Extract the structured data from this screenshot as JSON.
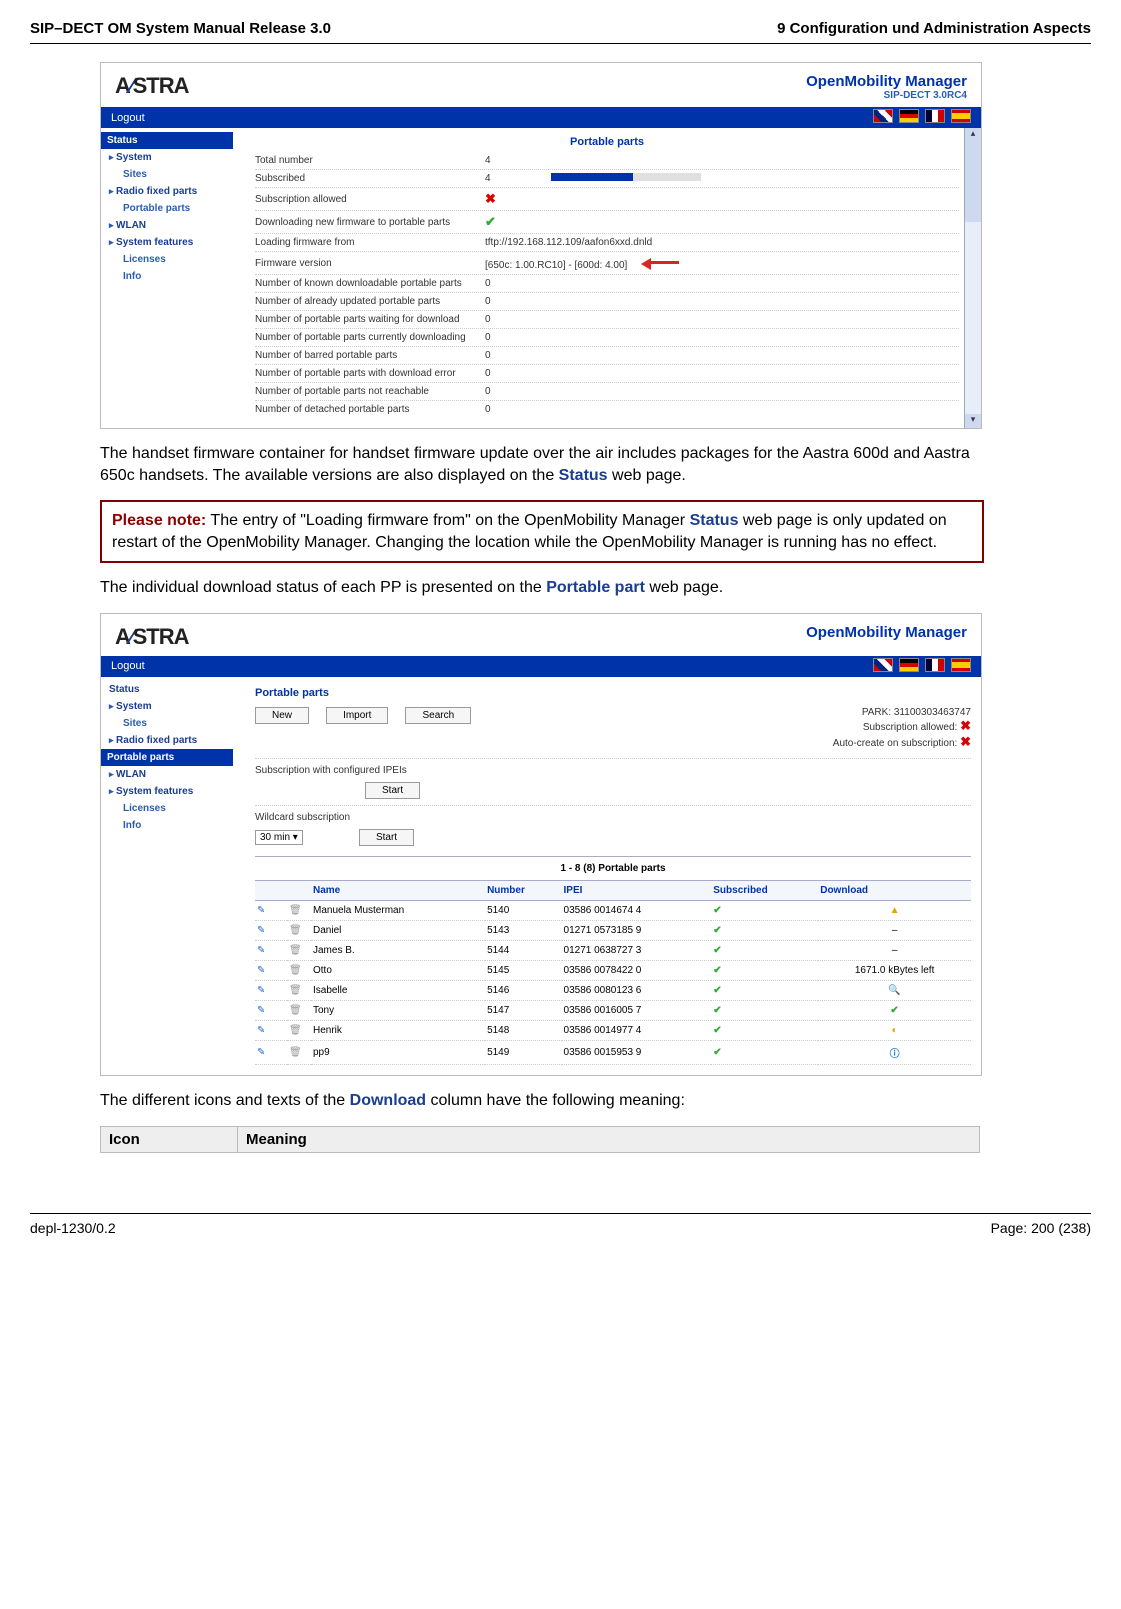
{
  "header": {
    "left": "SIP–DECT OM System Manual Release 3.0",
    "right": "9 Configuration und Administration Aspects"
  },
  "footer": {
    "left": "depl-1230/0.2",
    "right": "Page: 200 (238)"
  },
  "para1_a": "The handset firmware container for handset firmware update over the air includes packages for the Aastra 600d and Aastra 650c handsets. The available versions are also displayed on the ",
  "para1_link": "Status",
  "para1_b": " web page.",
  "note_label": "Please note:",
  "note_a": "The entry of \"Loading firmware from\" on the OpenMobility Manager ",
  "note_link": "Status",
  "note_b": " web page is only updated on restart of the OpenMobility Manager. Changing the location while the OpenMobility Manager is running has no effect.",
  "para2_a": "The individual download status of each PP is presented on the ",
  "para2_link": "Portable part",
  "para2_b": " web page.",
  "para3_a": "The different icons and texts of the ",
  "para3_link": "Download",
  "para3_b": " column have the following meaning:",
  "meaning_hdr": {
    "c1": "Icon",
    "c2": "Meaning"
  },
  "scr1": {
    "logo": "AASTRA",
    "omm_title": "OpenMobility Manager",
    "omm_sub": "SIP-DECT 3.0RC4",
    "logout": "Logout",
    "side": [
      "Status",
      "System",
      "Sites",
      "Radio fixed parts",
      "Portable parts",
      "WLAN",
      "System features",
      "Licenses",
      "Info"
    ],
    "section": "Portable parts",
    "rows": [
      {
        "k": "Total number",
        "v": "4"
      },
      {
        "k": "Subscribed",
        "v": "4",
        "bar": true
      },
      {
        "k": "Subscription allowed",
        "v": "x"
      },
      {
        "k": "Downloading new firmware to portable parts",
        "v": "✓"
      },
      {
        "k": "Loading firmware from",
        "v": "tftp://192.168.112.109/aafon6xxd.dnld"
      },
      {
        "k": "Firmware version",
        "v": "[650c: 1.00.RC10] - [600d: 4.00]",
        "arrow": true
      },
      {
        "k": "Number of known downloadable portable parts",
        "v": "0"
      },
      {
        "k": "Number of already updated portable parts",
        "v": "0"
      },
      {
        "k": "Number of portable parts waiting for download",
        "v": "0"
      },
      {
        "k": "Number of portable parts currently downloading",
        "v": "0"
      },
      {
        "k": "Number of barred portable parts",
        "v": "0"
      },
      {
        "k": "Number of portable parts with download error",
        "v": "0"
      },
      {
        "k": "Number of portable parts not reachable",
        "v": "0"
      },
      {
        "k": "Number of detached portable parts",
        "v": "0"
      }
    ]
  },
  "scr2": {
    "logo": "AASTRA",
    "omm_title": "OpenMobility Manager",
    "logout": "Logout",
    "side": [
      "Status",
      "System",
      "Sites",
      "Radio fixed parts",
      "Portable parts",
      "WLAN",
      "System features",
      "Licenses",
      "Info"
    ],
    "section": "Portable parts",
    "btn_new": "New",
    "btn_import": "Import",
    "btn_search": "Search",
    "park_lbl": "PARK: ",
    "park": "31100303463747",
    "sub_allowed_lbl": "Subscription allowed: ",
    "auto_create_lbl": "Auto-create on subscription: ",
    "sub_conf": "Subscription with configured IPEIs",
    "start": "Start",
    "wild": "Wildcard subscription",
    "dur": "30 min",
    "caption": "1 - 8 (8) Portable parts",
    "cols": [
      "Name",
      "Number",
      "IPEI",
      "Subscribed",
      "Download"
    ],
    "rows": [
      {
        "n": "Manuela Musterman",
        "num": "5140",
        "ipei": "03586 0014674 4",
        "dl": "warn"
      },
      {
        "n": "Daniel",
        "num": "5143",
        "ipei": "01271 0573185 9",
        "dl": "-"
      },
      {
        "n": "James B.",
        "num": "5144",
        "ipei": "01271 0638727 3",
        "dl": "-"
      },
      {
        "n": "Otto",
        "num": "5145",
        "ipei": "03586 0078422 0",
        "dl": "1671.0 kBytes left"
      },
      {
        "n": "Isabelle",
        "num": "5146",
        "ipei": "03586 0080123 6",
        "dl": "mag"
      },
      {
        "n": "Tony",
        "num": "5147",
        "ipei": "03586 0016005 7",
        "dl": "chk"
      },
      {
        "n": "Henrik",
        "num": "5148",
        "ipei": "03586 0014977 4",
        "dl": "prog"
      },
      {
        "n": "pp9",
        "num": "5149",
        "ipei": "03586 0015953 9",
        "dl": "info"
      }
    ]
  }
}
